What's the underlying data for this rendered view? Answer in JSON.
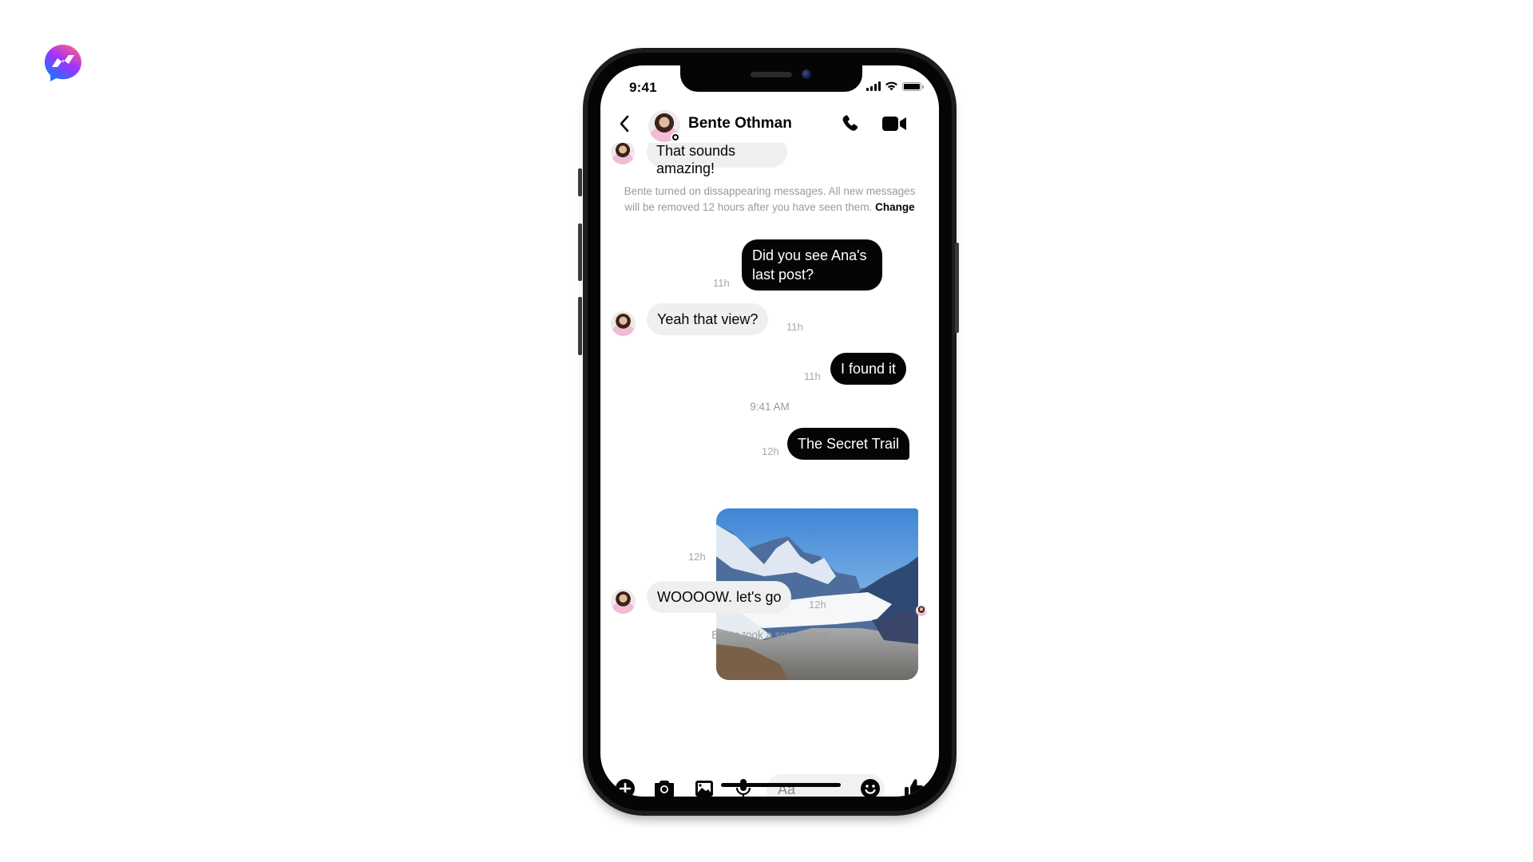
{
  "app": {
    "name": "Messenger",
    "brand_gradient": [
      "#0a7cff",
      "#a033ff",
      "#ff5c87"
    ]
  },
  "status_bar": {
    "time": "9:41",
    "signal_icon": "cellular-signal-icon",
    "wifi_icon": "wifi-icon",
    "battery_icon": "battery-icon"
  },
  "header": {
    "back_icon": "chevron-left-icon",
    "contact_name": "Bente Othman",
    "call_icon": "phone-icon",
    "video_icon": "video-camera-icon"
  },
  "conversation": {
    "clipped_message": "That sounds amazing!",
    "disappearing_notice": {
      "text": "Bente turned on dissappearing messages. All new messages will be removed 12 hours after you have seen them.",
      "action": "Change"
    },
    "messages": [
      {
        "from": "me",
        "text": "Did you see Ana's last post?",
        "time": "11h"
      },
      {
        "from": "Bente",
        "text": "Yeah that view?",
        "time": "11h"
      },
      {
        "from": "me",
        "text": "I found it",
        "time": "11h"
      },
      {
        "type": "divider",
        "text": "9:41 AM"
      },
      {
        "from": "me",
        "text": "The Secret Trail",
        "time": "12h"
      },
      {
        "from": "me",
        "type": "image",
        "alt": "snowy mountain valley with clouds",
        "time": "12h"
      },
      {
        "from": "Bente",
        "text": "WOOOOW. let's go",
        "time": "12h"
      }
    ],
    "screenshot_notice": "Bente took a screenshot"
  },
  "composer": {
    "placeholder": "Aa",
    "icons": [
      "plus-circle-icon",
      "camera-icon",
      "image-icon",
      "microphone-icon",
      "emoji-icon",
      "thumbs-up-icon"
    ]
  }
}
